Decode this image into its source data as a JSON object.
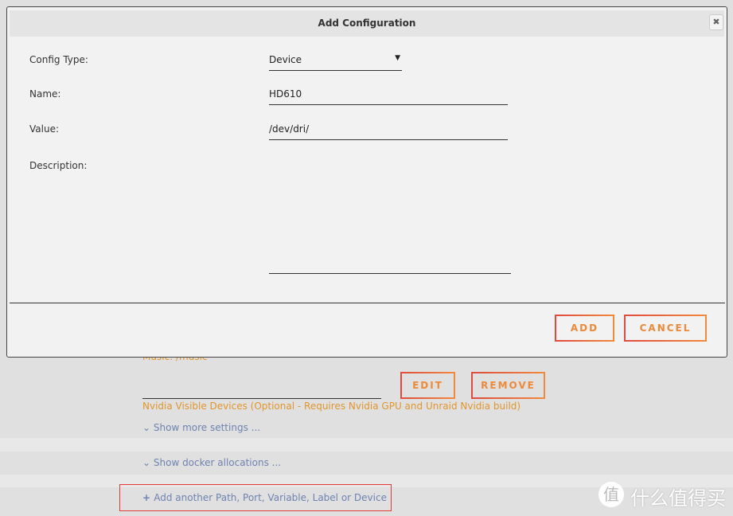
{
  "background": {
    "music_text": "Music: /music",
    "edit_label": "EDIT",
    "remove_label": "REMOVE",
    "nvidia_text": "Nvidia Visible Devices (Optional - Requires Nvidia GPU and Unraid Nvidia build)",
    "show_more": "Show more settings ...",
    "show_docker": "Show docker allocations ...",
    "add_another": "Add another Path, Port, Variable, Label or Device"
  },
  "modal": {
    "title": "Add Configuration",
    "close_icon": "close-icon",
    "fields": {
      "config_type_label": "Config Type:",
      "config_type_value": "Device",
      "name_label": "Name:",
      "name_value": "HD610",
      "value_label": "Value:",
      "value_value": "/dev/dri/",
      "description_label": "Description:",
      "description_value": ""
    },
    "add_label": "ADD",
    "cancel_label": "CANCEL"
  },
  "watermark": {
    "logo_char": "值",
    "text": "什么值得买"
  },
  "colors": {
    "accent_orange": "#ec8a3a",
    "link_blue": "#6f83b0",
    "highlight_red": "#e53935"
  }
}
